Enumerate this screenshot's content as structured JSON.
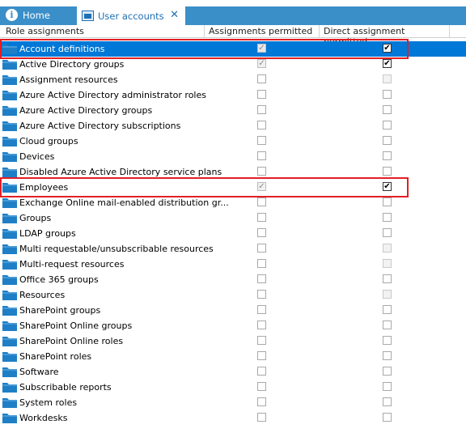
{
  "tabs": [
    {
      "label": "Home",
      "icon": "info-icon"
    },
    {
      "label": "User accounts",
      "icon": "user-accounts-icon",
      "close": "✕"
    }
  ],
  "columns": [
    "Role assignments",
    "Assignments permitted",
    "Direct assignment permitted"
  ],
  "rows": [
    {
      "label": "Account definitions",
      "perm": "grayed-checked",
      "direct": "checked",
      "selected": true
    },
    {
      "label": "Active Directory groups",
      "perm": "grayed-checked",
      "direct": "checked"
    },
    {
      "label": "Assignment resources",
      "perm": "unchecked",
      "direct": "disabled"
    },
    {
      "label": "Azure Active Directory administrator roles",
      "perm": "unchecked",
      "direct": "unchecked"
    },
    {
      "label": "Azure Active Directory groups",
      "perm": "unchecked",
      "direct": "unchecked"
    },
    {
      "label": "Azure Active Directory subscriptions",
      "perm": "unchecked",
      "direct": "unchecked"
    },
    {
      "label": "Cloud groups",
      "perm": "unchecked",
      "direct": "unchecked"
    },
    {
      "label": "Devices",
      "perm": "unchecked",
      "direct": "unchecked"
    },
    {
      "label": "Disabled Azure Active Directory service plans",
      "perm": "unchecked",
      "direct": "unchecked"
    },
    {
      "label": "Employees",
      "perm": "grayed-checked",
      "direct": "checked"
    },
    {
      "label": "Exchange Online mail-enabled distribution gr...",
      "perm": "unchecked",
      "direct": "unchecked"
    },
    {
      "label": "Groups",
      "perm": "unchecked",
      "direct": "unchecked"
    },
    {
      "label": "LDAP groups",
      "perm": "unchecked",
      "direct": "unchecked"
    },
    {
      "label": "Multi requestable/unsubscribable resources",
      "perm": "unchecked",
      "direct": "disabled"
    },
    {
      "label": "Multi-request resources",
      "perm": "unchecked",
      "direct": "disabled"
    },
    {
      "label": "Office 365 groups",
      "perm": "unchecked",
      "direct": "unchecked"
    },
    {
      "label": "Resources",
      "perm": "unchecked",
      "direct": "disabled"
    },
    {
      "label": "SharePoint groups",
      "perm": "unchecked",
      "direct": "unchecked"
    },
    {
      "label": "SharePoint Online groups",
      "perm": "unchecked",
      "direct": "unchecked"
    },
    {
      "label": "SharePoint Online roles",
      "perm": "unchecked",
      "direct": "unchecked"
    },
    {
      "label": "SharePoint roles",
      "perm": "unchecked",
      "direct": "unchecked"
    },
    {
      "label": "Software",
      "perm": "unchecked",
      "direct": "unchecked"
    },
    {
      "label": "Subscribable reports",
      "perm": "unchecked",
      "direct": "unchecked"
    },
    {
      "label": "System roles",
      "perm": "unchecked",
      "direct": "unchecked"
    },
    {
      "label": "Workdesks",
      "perm": "unchecked",
      "direct": "unchecked"
    }
  ],
  "highlighted_rows": [
    "Account definitions",
    "Employees"
  ],
  "colors": {
    "accent": "#3a8fc9",
    "selection": "#0078d7",
    "highlight": "#e21f26",
    "folder": "#1e7fc6"
  }
}
